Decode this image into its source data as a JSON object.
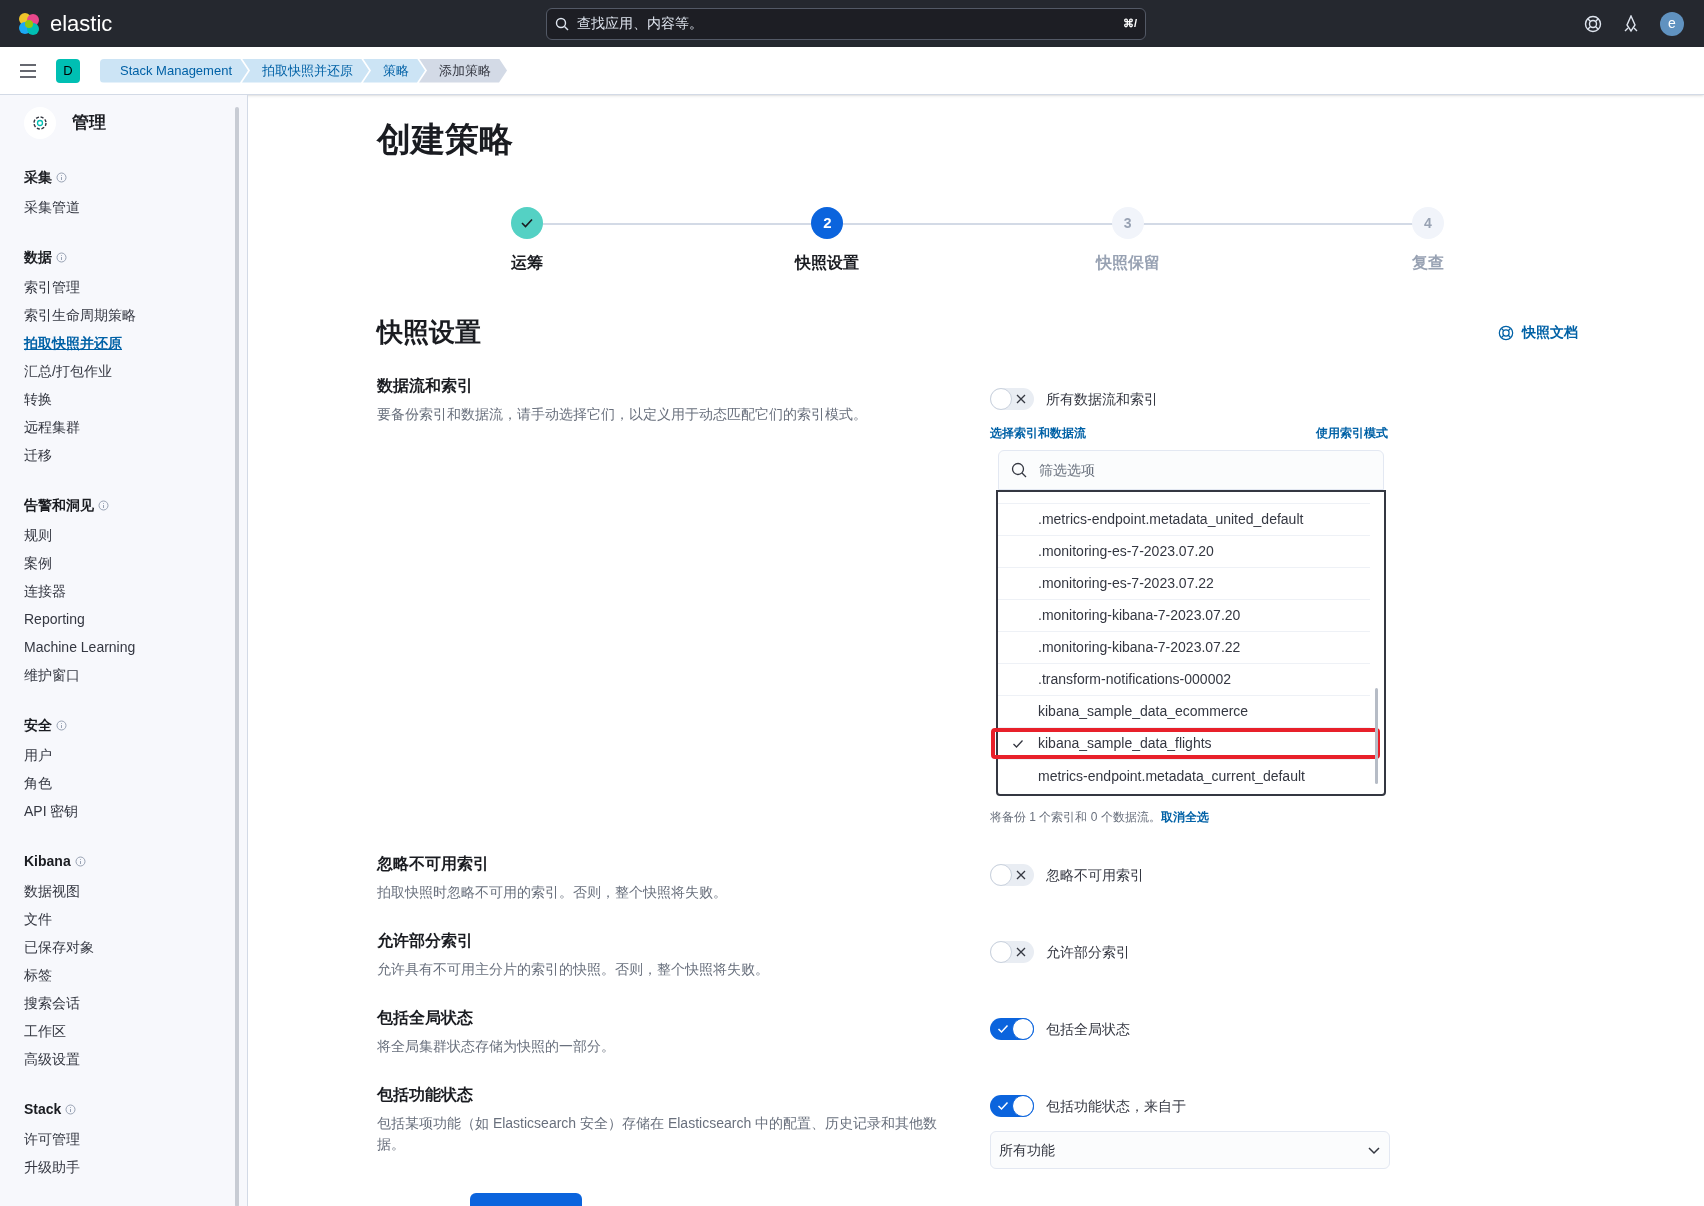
{
  "header": {
    "logo_text": "elastic",
    "search_placeholder": "查找应用、内容等。",
    "shortcut": "⌘/",
    "avatar": "e"
  },
  "space_badge": "D",
  "breadcrumbs": [
    {
      "label": "Stack Management",
      "selected": false
    },
    {
      "label": "拍取快照并还原",
      "selected": false
    },
    {
      "label": "策略",
      "selected": false
    },
    {
      "label": "添加策略",
      "selected": true
    }
  ],
  "sidebar": {
    "title": "管理",
    "groups": [
      {
        "title": "采集",
        "items": [
          {
            "label": "采集管道",
            "selected": false
          }
        ]
      },
      {
        "title": "数据",
        "items": [
          {
            "label": "索引管理",
            "selected": false
          },
          {
            "label": "索引生命周期策略",
            "selected": false
          },
          {
            "label": "拍取快照并还原",
            "selected": true
          },
          {
            "label": "汇总/打包作业",
            "selected": false
          },
          {
            "label": "转换",
            "selected": false
          },
          {
            "label": "远程集群",
            "selected": false
          },
          {
            "label": "迁移",
            "selected": false
          }
        ]
      },
      {
        "title": "告警和洞见",
        "items": [
          {
            "label": "规则",
            "selected": false
          },
          {
            "label": "案例",
            "selected": false
          },
          {
            "label": "连接器",
            "selected": false
          },
          {
            "label": "Reporting",
            "selected": false
          },
          {
            "label": "Machine Learning",
            "selected": false
          },
          {
            "label": "维护窗口",
            "selected": false
          }
        ]
      },
      {
        "title": "安全",
        "items": [
          {
            "label": "用户",
            "selected": false
          },
          {
            "label": "角色",
            "selected": false
          },
          {
            "label": "API 密钥",
            "selected": false
          }
        ]
      },
      {
        "title": "Kibana",
        "items": [
          {
            "label": "数据视图",
            "selected": false
          },
          {
            "label": "文件",
            "selected": false
          },
          {
            "label": "已保存对象",
            "selected": false
          },
          {
            "label": "标签",
            "selected": false
          },
          {
            "label": "搜索会话",
            "selected": false
          },
          {
            "label": "工作区",
            "selected": false
          },
          {
            "label": "高级设置",
            "selected": false
          }
        ]
      },
      {
        "title": "Stack",
        "items": [
          {
            "label": "许可管理",
            "selected": false
          },
          {
            "label": "升级助手",
            "selected": false
          }
        ]
      }
    ]
  },
  "page_title": "创建策略",
  "steps": [
    {
      "label": "运筹",
      "kind": "complete"
    },
    {
      "number": "2",
      "label": "快照设置",
      "kind": "current"
    },
    {
      "number": "3",
      "label": "快照保留",
      "kind": "pending"
    },
    {
      "number": "4",
      "label": "复查",
      "kind": "pending"
    }
  ],
  "section_title": "快照设置",
  "docs_link": "快照文档",
  "indices": {
    "title": "数据流和索引",
    "description": "要备份索引和数据流，请手动选择它们，以定义用于动态匹配它们的索引模式。",
    "toggle": {
      "label": "所有数据流和索引",
      "on": false
    },
    "select_link": "选择索引和数据流",
    "pattern_link": "使用索引模式",
    "filter_placeholder": "筛选选项",
    "options": [
      {
        "label": ".metrics-endpoint.metadata_united_default",
        "checked": false,
        "highlighted": false
      },
      {
        "label": ".monitoring-es-7-2023.07.20",
        "checked": false,
        "highlighted": false
      },
      {
        "label": ".monitoring-es-7-2023.07.22",
        "checked": false,
        "highlighted": false
      },
      {
        "label": ".monitoring-kibana-7-2023.07.20",
        "checked": false,
        "highlighted": false
      },
      {
        "label": ".monitoring-kibana-7-2023.07.22",
        "checked": false,
        "highlighted": false
      },
      {
        "label": ".transform-notifications-000002",
        "checked": false,
        "highlighted": false
      },
      {
        "label": "kibana_sample_data_ecommerce",
        "checked": false,
        "highlighted": false
      },
      {
        "label": "kibana_sample_data_flights",
        "checked": true,
        "highlighted": true
      },
      {
        "label": "metrics-endpoint.metadata_current_default",
        "checked": false,
        "highlighted": false
      }
    ],
    "summary": "将备份 1 个索引和 0 个数据流。",
    "clear_link": "取消全选"
  },
  "settings": [
    {
      "title": "忽略不可用索引",
      "description": "拍取快照时忽略不可用的索引。否则，整个快照将失败。",
      "toggle": {
        "label": "忽略不可用索引",
        "on": false
      }
    },
    {
      "title": "允许部分索引",
      "description": "允许具有不可用主分片的索引的快照。否则，整个快照将失败。",
      "toggle": {
        "label": "允许部分索引",
        "on": false
      }
    },
    {
      "title": "包括全局状态",
      "description": "将全局集群状态存储为快照的一部分。",
      "toggle": {
        "label": "包括全局状态",
        "on": true
      }
    },
    {
      "title": "包括功能状态",
      "description": "包括某项功能（如 Elasticsearch 安全）存储在 Elasticsearch 中的配置、历史记录和其他数据。",
      "toggle": {
        "label": "包括功能状态，来自于",
        "on": true
      },
      "select_value": "所有功能"
    }
  ]
}
